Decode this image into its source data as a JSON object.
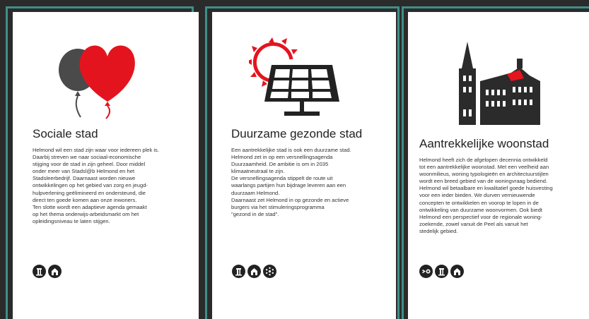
{
  "colors": {
    "accent_red": "#e4141e",
    "dark": "#2b2b2b",
    "frame": "#3f8f88"
  },
  "cards": [
    {
      "title": "Sociale stad",
      "illustration": "balloons-heart-icon",
      "body": [
        "Helmond wil een stad zijn waar voor iedereen plek is.",
        "Daarbij streven we naar sociaal-economische",
        "stijging voor de stad in zijn geheel. Door middel",
        "onder meer van Stadsl@b Helmond en het",
        "Stadsleerbedrijf. Daarnaast worden nieuwe",
        "ontwikkelingen op het gebied van zorg en jeugd-",
        "hulpverlening geëlimineerd en ondersteund, die",
        "direct ten goede komen aan onze inwoners.",
        "Ten slotte wordt een adaptieve agenda gemaakt",
        "op het thema onderwijs-arbeidsmarkt om het",
        "opleidingsniveau te laten stijgen."
      ],
      "theme_icons": [
        "building-icon",
        "house-icon"
      ]
    },
    {
      "title": "Duurzame gezonde stad",
      "illustration": "solar-panel-sun-icon",
      "body": [
        "Een aantrekkelijke stad is ook een duurzame stad.",
        "Helmond zet in op een versnellingsagenda",
        "Duurzaamheid. De ambitie is om in 2035",
        "klimaatneutraal te zijn.",
        "De versnellingsagenda stippelt de route uit",
        "waarlangs partijen hun bijdrage leveren aan een",
        "duurzaam Helmond.",
        "Daarnaast zet Helmond in op gezonde en actieve",
        "burgers via het stimuleringsprogramma",
        "\"gezond in de stad\"."
      ],
      "theme_icons": [
        "building-icon",
        "house-icon",
        "network-icon"
      ]
    },
    {
      "title": "Aantrekkelijke woonstad",
      "illustration": "castle-icon",
      "body": [
        "Helmond heeft zich de afgelopen decennia ontwikkeld",
        "tot een aantrekkelijke woonstad. Met een veelheid aan",
        "woonmilieus, woning typologieën en architectuurstijlen",
        "wordt een breed gebied van de woningvraag bediend.",
        "Helmond wil betaalbare en kwalitatief goede huisvesting",
        "voor een ieder bieden. We durven vernieuwende",
        "concepten te ontwikkelen en voorop te lopen in de",
        "ontwikkeling van duurzame woonvormen. Ook biedt",
        "Helmond een perspectief voor de regionale woning-",
        "zoekende, zowel vanuit de Peel als vanuit het",
        "stedelijk gebied."
      ],
      "theme_icons": [
        "connect-icon",
        "building-icon",
        "house-icon"
      ]
    }
  ]
}
